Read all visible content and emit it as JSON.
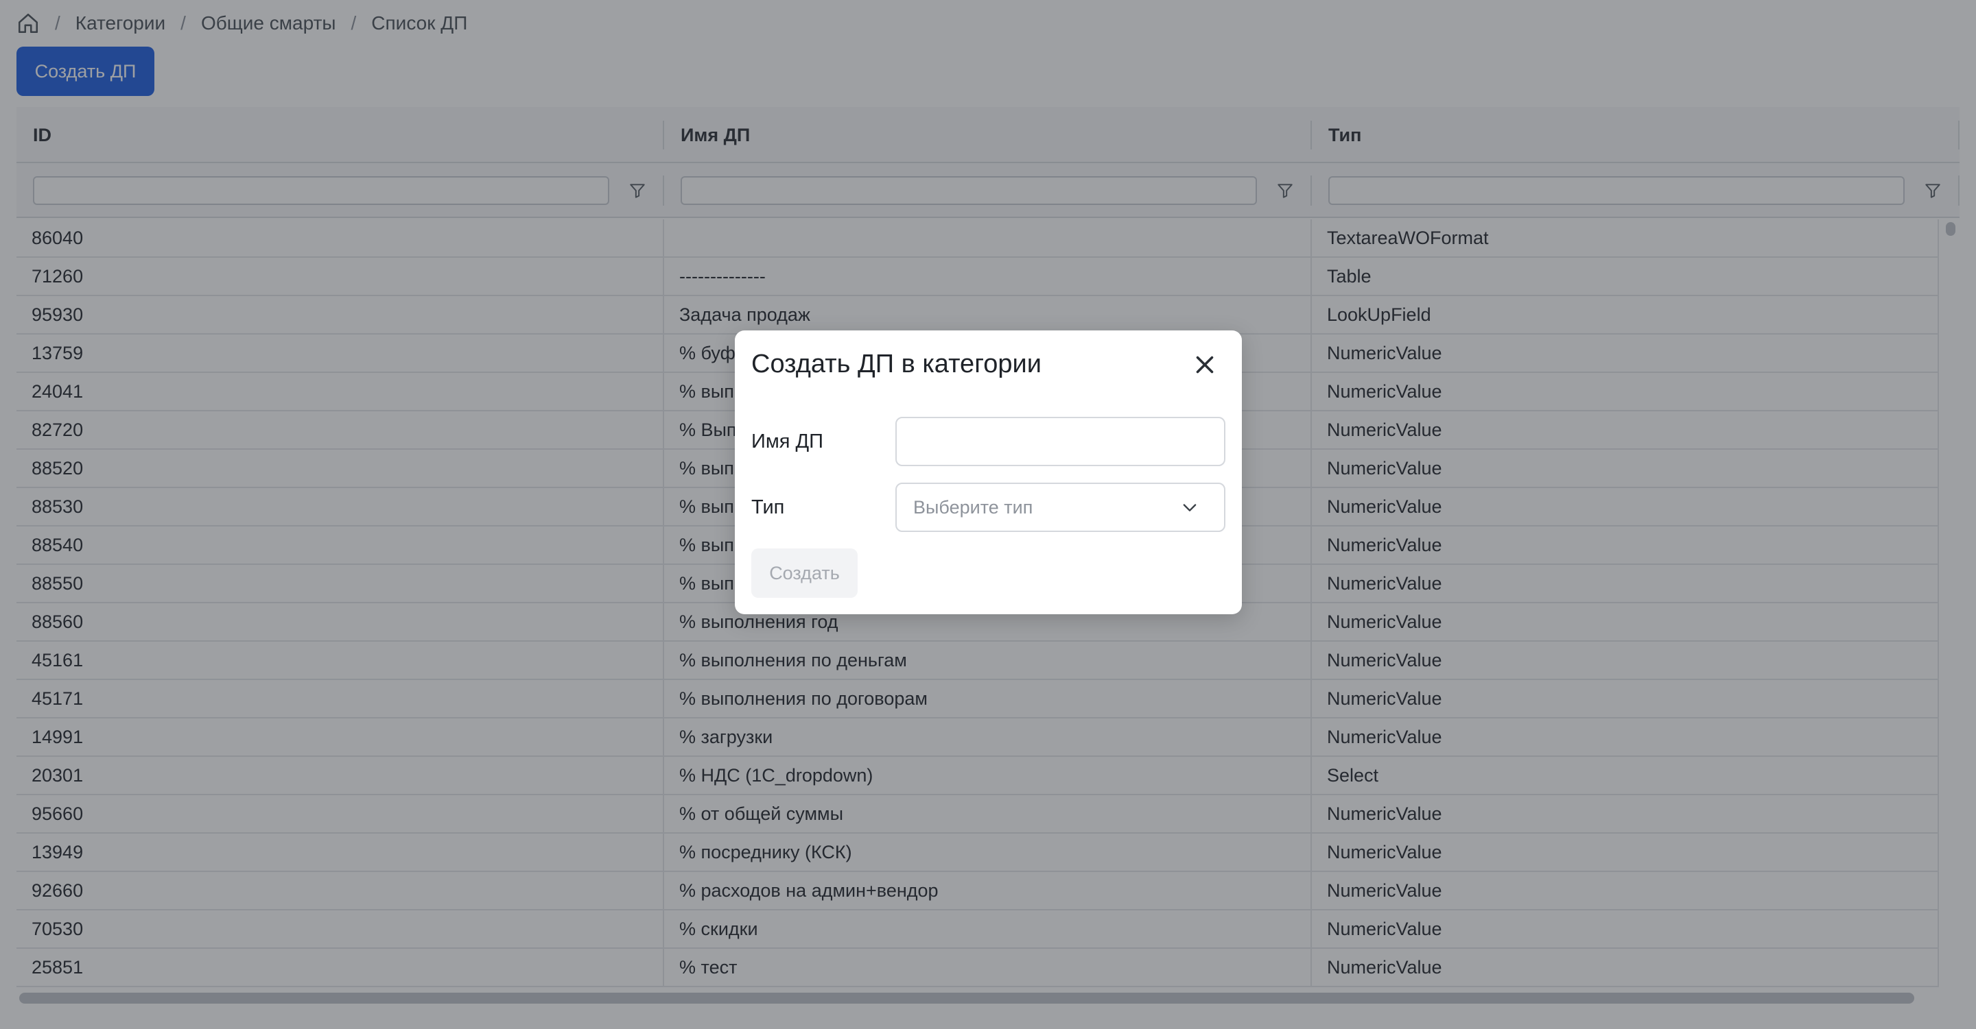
{
  "breadcrumb": {
    "items": [
      "Категории",
      "Общие смарты",
      "Список ДП"
    ],
    "separator": "/"
  },
  "toolbar": {
    "create_label": "Создать ДП"
  },
  "table": {
    "columns": [
      "ID",
      "Имя ДП",
      "Тип"
    ],
    "rows": [
      [
        "86040",
        "",
        "TextareaWOFormat"
      ],
      [
        "71260",
        "--------------",
        "Table"
      ],
      [
        "95930",
        "Задача продаж",
        "LookUpField"
      ],
      [
        "13759",
        "% буф",
        "NumericValue"
      ],
      [
        "24041",
        "% вып",
        "NumericValue"
      ],
      [
        "82720",
        "% Вып",
        "NumericValue"
      ],
      [
        "88520",
        "% вып",
        "NumericValue"
      ],
      [
        "88530",
        "% вып",
        "NumericValue"
      ],
      [
        "88540",
        "% вып",
        "NumericValue"
      ],
      [
        "88550",
        "% вып",
        "NumericValue"
      ],
      [
        "88560",
        "% выполнения год",
        "NumericValue"
      ],
      [
        "45161",
        "% выполнения по деньгам",
        "NumericValue"
      ],
      [
        "45171",
        "% выполнения по договорам",
        "NumericValue"
      ],
      [
        "14991",
        "% загрузки",
        "NumericValue"
      ],
      [
        "20301",
        "% НДС (1C_dropdown)",
        "Select"
      ],
      [
        "95660",
        "% от общей суммы",
        "NumericValue"
      ],
      [
        "13949",
        "% посреднику (КСК)",
        "NumericValue"
      ],
      [
        "92660",
        "% расходов на админ+вендор",
        "NumericValue"
      ],
      [
        "70530",
        "% скидки",
        "NumericValue"
      ],
      [
        "25851",
        "% тест",
        "NumericValue"
      ]
    ]
  },
  "modal": {
    "title": "Создать ДП в категории",
    "name_label": "Имя ДП",
    "name_value": "",
    "type_label": "Тип",
    "type_placeholder": "Выберите тип",
    "submit_label": "Создать"
  },
  "colors": {
    "primary": "#1f5fe0",
    "overlay": "rgba(40,44,52,0.45)"
  },
  "icons": {
    "home": "home-icon",
    "filter": "filter-icon",
    "close": "close-icon",
    "chevron": "chevron-down-icon"
  }
}
